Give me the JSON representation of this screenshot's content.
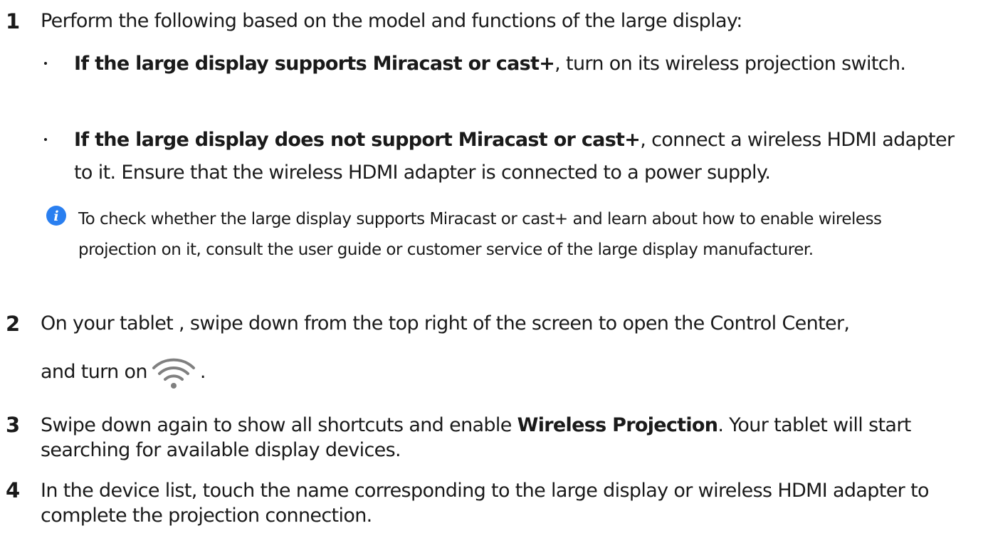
{
  "steps": [
    {
      "number": "1",
      "text": "Perform the following based on the model and functions of the large display:"
    },
    {
      "number": "2",
      "text_line1": "On your tablet , swipe down from the top right of the screen to open the Control Center,",
      "text_line2_before": "and turn on",
      "text_line2_after": ".",
      "icon": "wifi-icon"
    },
    {
      "number": "3",
      "text_before": "Swipe down again to show all shortcuts and enable ",
      "bold": "Wireless Projection",
      "text_after": ". Your tablet will start searching for available display devices."
    },
    {
      "number": "4",
      "text": "In the device list, touch the name corresponding to the large display or wireless HDMI adapter to complete the projection connection."
    }
  ],
  "bullets": [
    {
      "bold": "If the large display supports Miracast or cast+",
      "text": ", turn on its wireless projection switch."
    },
    {
      "bold": "If the large display does not support Miracast or cast+",
      "text": ", connect a wireless HDMI adapter to it. Ensure that the wireless HDMI adapter is connected to a power supply."
    }
  ],
  "note": {
    "icon": "info-icon",
    "text": "To check whether the large display supports Miracast or cast+ and learn about how to enable wireless projection on it, consult the user guide or customer service of the large display manufacturer."
  },
  "colors": {
    "text": "#1a1a1a",
    "info_icon": "#2a7ff0",
    "wifi_icon": "#808080"
  }
}
